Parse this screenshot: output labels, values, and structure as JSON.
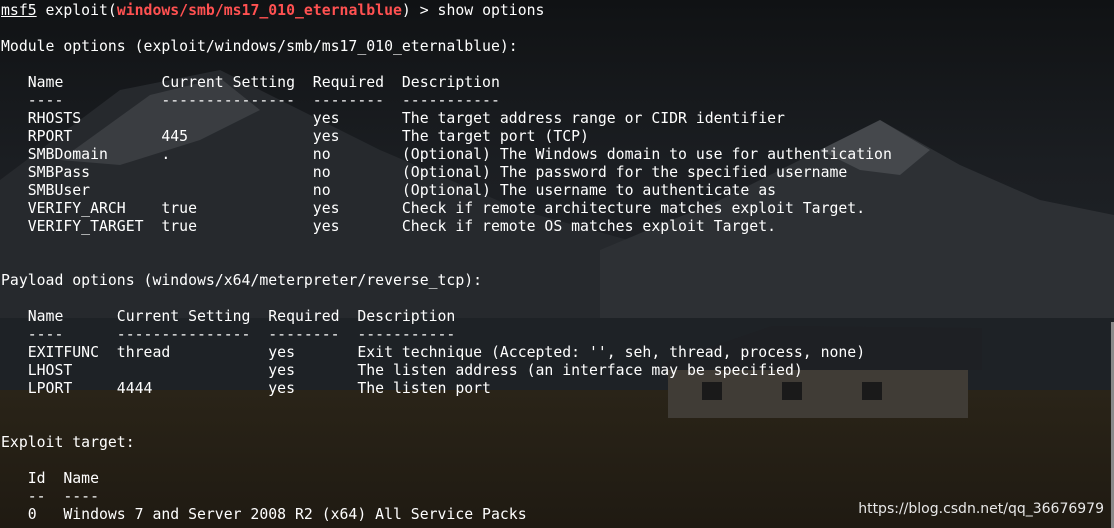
{
  "prompt": {
    "name": "msf5",
    "cmd_prefix": " exploit(",
    "module": "windows/smb/ms17_010_eternalblue",
    "cmd_suffix": ") > show options"
  },
  "module_options": {
    "heading": "Module options (exploit/windows/smb/ms17_010_eternalblue):",
    "header": "   Name           Current Setting  Required  Description",
    "underline": "   ----           ---------------  --------  -----------",
    "rows": [
      "   RHOSTS                          yes       The target address range or CIDR identifier",
      "   RPORT          445              yes       The target port (TCP)",
      "   SMBDomain      .                no        (Optional) The Windows domain to use for authentication",
      "   SMBPass                         no        (Optional) The password for the specified username",
      "   SMBUser                         no        (Optional) The username to authenticate as",
      "   VERIFY_ARCH    true             yes       Check if remote architecture matches exploit Target.",
      "   VERIFY_TARGET  true             yes       Check if remote OS matches exploit Target."
    ]
  },
  "payload_options": {
    "heading": "Payload options (windows/x64/meterpreter/reverse_tcp):",
    "header": "   Name      Current Setting  Required  Description",
    "underline": "   ----      ---------------  --------  -----------",
    "rows": [
      "   EXITFUNC  thread           yes       Exit technique (Accepted: '', seh, thread, process, none)",
      "   LHOST                      yes       The listen address (an interface may be specified)",
      "   LPORT     4444             yes       The listen port"
    ]
  },
  "exploit_target": {
    "heading": "Exploit target:",
    "header": "   Id  Name",
    "underline": "   --  ----",
    "rows": [
      "   0   Windows 7 and Server 2008 R2 (x64) All Service Packs"
    ]
  },
  "watermark": "https://blog.csdn.net/qq_36676979"
}
